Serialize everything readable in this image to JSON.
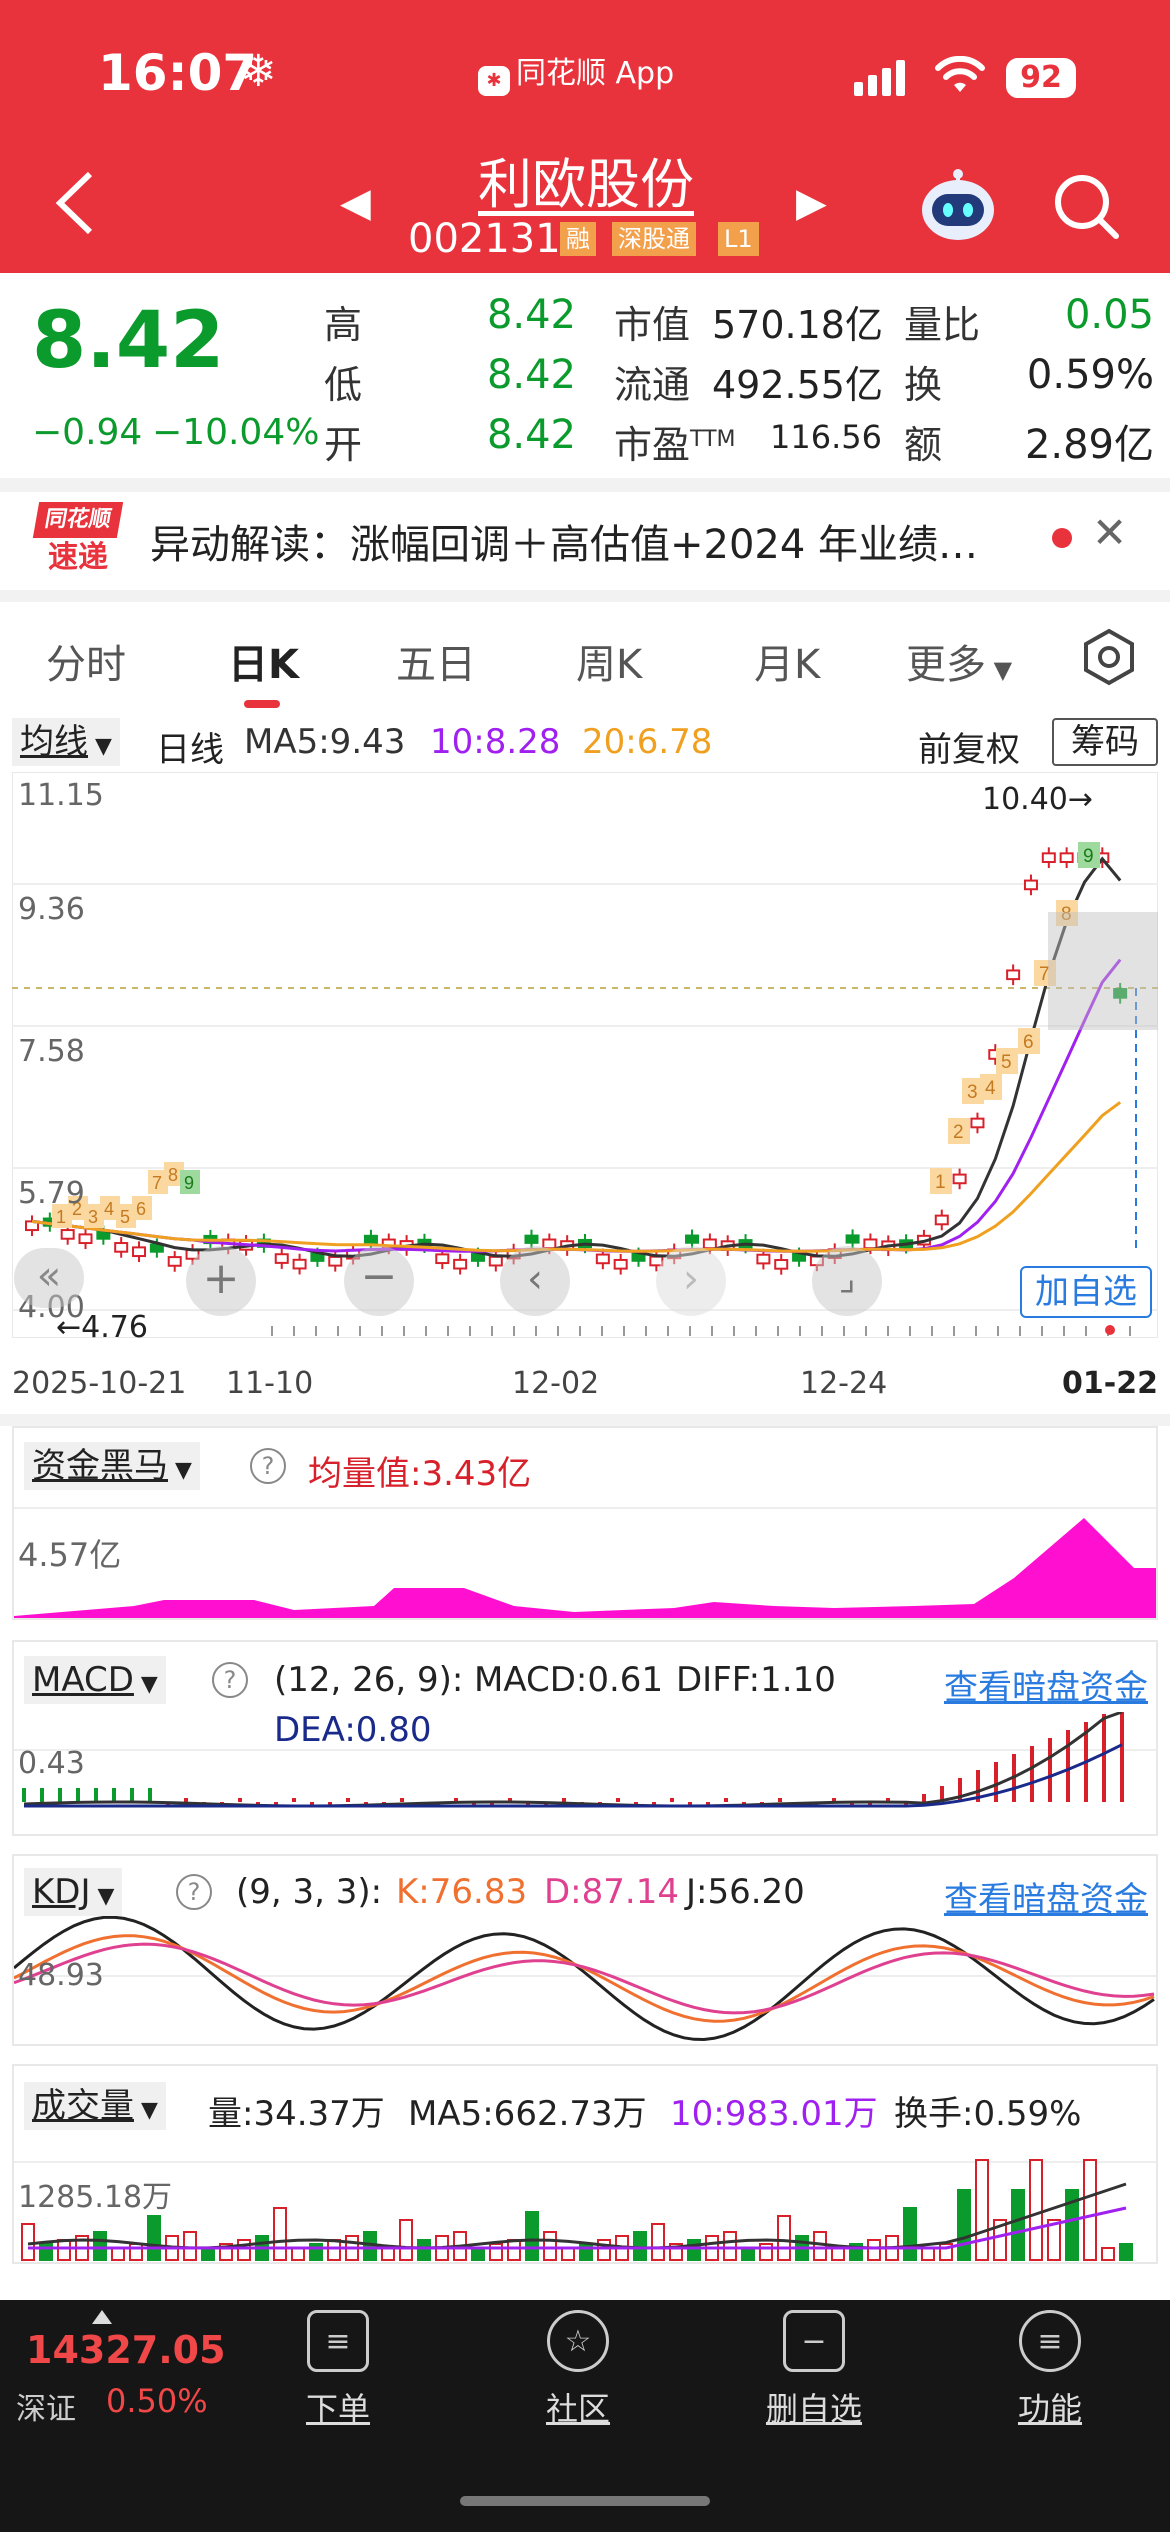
{
  "status": {
    "time": "16:07",
    "app": "同花顺 App",
    "battery": "92"
  },
  "stock": {
    "name": "利欧股份",
    "code": "002131",
    "tags": [
      "融",
      "深股通",
      "L1"
    ]
  },
  "quote": {
    "price": "8.42",
    "change": "−0.94",
    "change_pct": "−10.04%",
    "high_label": "高",
    "high": "8.42",
    "low_label": "低",
    "low": "8.42",
    "open_label": "开",
    "open": "8.42",
    "mcap_label": "市值",
    "mcap": "570.18亿",
    "float_label": "流通",
    "float": "492.55亿",
    "pe_label": "市盈",
    "pe_sup": "TTM",
    "pe": "116.56",
    "vr_label": "量比",
    "vr": "0.05",
    "turn_label": "换",
    "turn": "0.59%",
    "amt_label": "额",
    "amt": "2.89亿"
  },
  "news": {
    "logo_top": "同花顺",
    "logo_bottom": "速递",
    "text": "异动解读：涨幅回调＋高估值+2024 年业绩…"
  },
  "tabs": [
    {
      "label": "分时"
    },
    {
      "label": "日K"
    },
    {
      "label": "五日"
    },
    {
      "label": "周K"
    },
    {
      "label": "月K"
    },
    {
      "label": "更多"
    }
  ],
  "kline": {
    "ma_chip": "均线",
    "period": "日线",
    "ma5": "MA5:9.43",
    "ma10": "10:8.28",
    "ma20": "20:6.78",
    "adjust": "前复权",
    "chip_btn": "筹码",
    "y_labels": [
      "11.15",
      "9.36",
      "7.58",
      "5.79",
      "4.00"
    ],
    "max_label": "10.40→",
    "min_label": "←4.76",
    "x_labels": [
      "2025-10-21",
      "11-10",
      "12-02",
      "12-24",
      "01-22"
    ],
    "add_watch": "加自选",
    "ma5_color": "#333333",
    "ma10_color": "#a020f0",
    "ma20_color": "#f0a020",
    "up_color": "#d8202a",
    "down_color": "#0b9b2d",
    "nine_turn_left": [
      "1",
      "2",
      "3",
      "4",
      "5",
      "6",
      "7",
      "8",
      "9"
    ],
    "nine_turn_right": [
      "1",
      "2",
      "3",
      "4",
      "5",
      "6",
      "7",
      "8",
      "9"
    ]
  },
  "fund": {
    "chip": "资金黑马",
    "avg": "均量值:3.43亿",
    "y_label": "4.57亿",
    "fill_color": "#ff10d0"
  },
  "macd": {
    "chip": "MACD",
    "params": "(12, 26, 9):",
    "macd": "MACD:0.61",
    "diff": "DIFF:1.10",
    "dea": "DEA:0.80",
    "y_label": "0.43",
    "link": "查看暗盘资金"
  },
  "kdj": {
    "chip": "KDJ",
    "params": "(9, 3, 3):",
    "k": "K:76.83",
    "d": "D:87.14",
    "j": "J:56.20",
    "y_label": "48.93",
    "link": "查看暗盘资金"
  },
  "volume": {
    "chip": "成交量",
    "vol": "量:34.37万",
    "ma5": "MA5:662.73万",
    "ma10": "10:983.01万",
    "turnover": "换手:0.59%",
    "y_label": "1285.18万"
  },
  "bottom": {
    "index_value": "14327.05",
    "index_name": "深证",
    "index_pct": "0.50%",
    "nav": [
      {
        "label": "下单"
      },
      {
        "label": "社区"
      },
      {
        "label": "删自选"
      },
      {
        "label": "功能"
      }
    ]
  }
}
